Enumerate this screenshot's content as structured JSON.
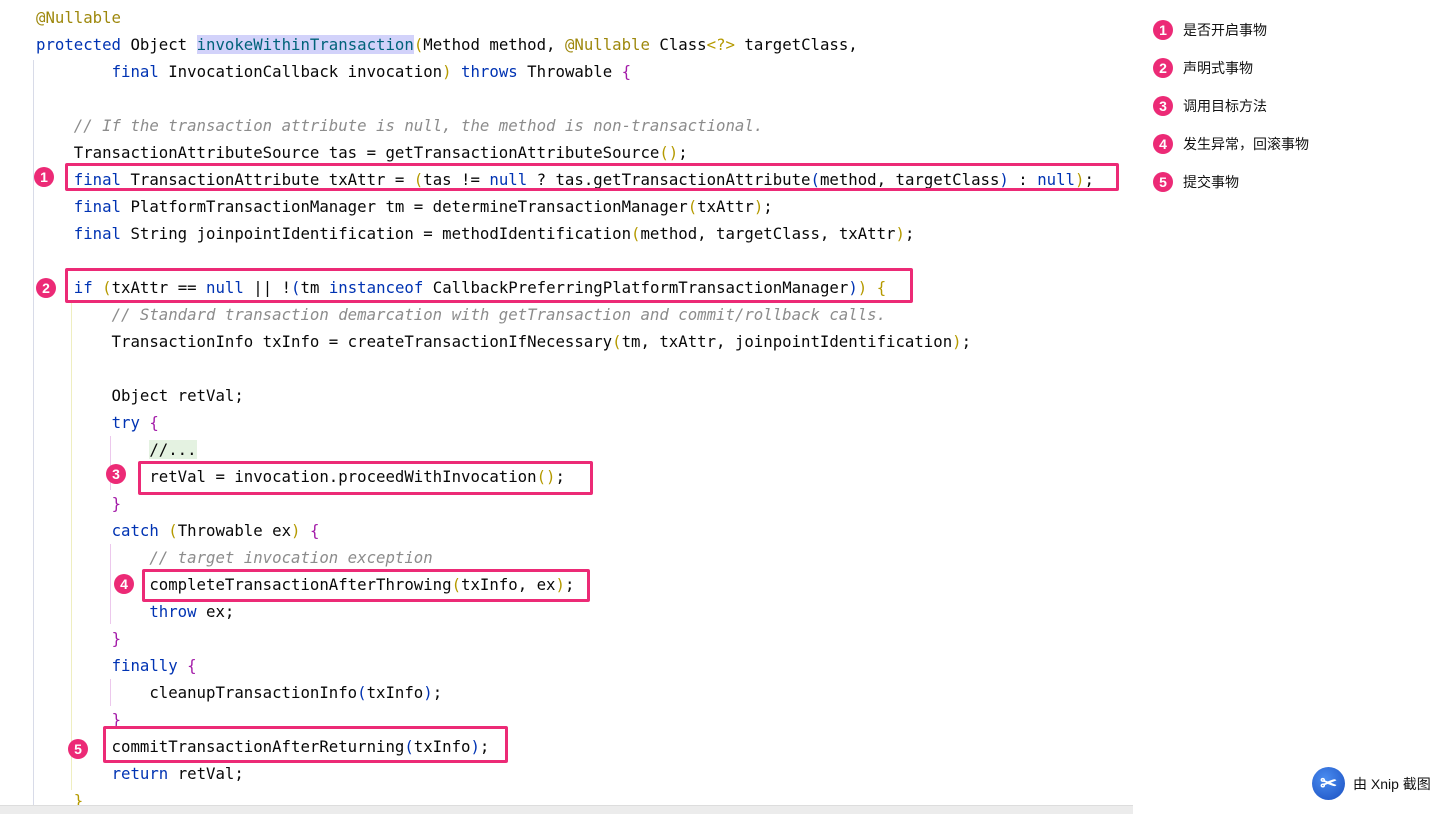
{
  "code": [
    [
      [
        "a",
        "@Nullable"
      ]
    ],
    [
      [
        "k",
        "protected "
      ],
      [
        "p",
        "Object "
      ],
      [
        "m",
        "invokeWithinTransaction"
      ],
      [
        "y",
        "("
      ],
      [
        "p",
        "Method method, "
      ],
      [
        "a",
        "@Nullable "
      ],
      [
        "p",
        "Class"
      ],
      [
        "y",
        "<?>"
      ],
      [
        "p",
        " targetClass,"
      ]
    ],
    [
      [
        "p",
        "        "
      ],
      [
        "k",
        "final "
      ],
      [
        "p",
        "InvocationCallback invocation"
      ],
      [
        "y",
        ")"
      ],
      [
        "p",
        " "
      ],
      [
        "k",
        "throws "
      ],
      [
        "p",
        "Throwable "
      ],
      [
        "b",
        "{"
      ]
    ],
    [],
    [
      [
        "p",
        "    "
      ],
      [
        "c",
        "// If the transaction attribute is null, the method is non-transactional."
      ]
    ],
    [
      [
        "p",
        "    TransactionAttributeSource tas = getTransactionAttributeSource"
      ],
      [
        "y",
        "()"
      ],
      [
        "p",
        ";"
      ]
    ],
    [
      [
        "p",
        "    "
      ],
      [
        "k",
        "final "
      ],
      [
        "p",
        "TransactionAttribute txAttr = "
      ],
      [
        "y",
        "("
      ],
      [
        "p",
        "tas != "
      ],
      [
        "k",
        "null"
      ],
      [
        "p",
        " ? tas.getTransactionAttribute"
      ],
      [
        "bl",
        "("
      ],
      [
        "p",
        "method, targetClass"
      ],
      [
        "bl",
        ")"
      ],
      [
        "p",
        " : "
      ],
      [
        "k",
        "null"
      ],
      [
        "y",
        ")"
      ],
      [
        "p",
        ";"
      ]
    ],
    [
      [
        "p",
        "    "
      ],
      [
        "k",
        "final "
      ],
      [
        "p",
        "PlatformTransactionManager tm = determineTransactionManager"
      ],
      [
        "y",
        "("
      ],
      [
        "p",
        "txAttr"
      ],
      [
        "y",
        ")"
      ],
      [
        "p",
        ";"
      ]
    ],
    [
      [
        "p",
        "    "
      ],
      [
        "k",
        "final "
      ],
      [
        "p",
        "String joinpointIdentification = methodIdentification"
      ],
      [
        "y",
        "("
      ],
      [
        "p",
        "method, targetClass, txAttr"
      ],
      [
        "y",
        ")"
      ],
      [
        "p",
        ";"
      ]
    ],
    [],
    [
      [
        "p",
        "    "
      ],
      [
        "k",
        "if "
      ],
      [
        "y",
        "("
      ],
      [
        "p",
        "txAttr == "
      ],
      [
        "k",
        "null"
      ],
      [
        "p",
        " || !"
      ],
      [
        "bl",
        "("
      ],
      [
        "p",
        "tm "
      ],
      [
        "k",
        "instanceof "
      ],
      [
        "p",
        "CallbackPreferringPlatformTransactionManager"
      ],
      [
        "bl",
        ")"
      ],
      [
        "y",
        ")"
      ],
      [
        "p",
        " "
      ],
      [
        "y",
        "{"
      ]
    ],
    [
      [
        "p",
        "        "
      ],
      [
        "c",
        "// Standard transaction demarcation with getTransaction and commit/rollback calls."
      ]
    ],
    [
      [
        "p",
        "        TransactionInfo txInfo = createTransactionIfNecessary"
      ],
      [
        "y",
        "("
      ],
      [
        "p",
        "tm, txAttr, joinpointIdentification"
      ],
      [
        "y",
        ")"
      ],
      [
        "p",
        ";"
      ]
    ],
    [],
    [
      [
        "p",
        "        Object retVal;"
      ]
    ],
    [
      [
        "p",
        "        "
      ],
      [
        "k",
        "try "
      ],
      [
        "b",
        "{"
      ]
    ],
    [
      [
        "p",
        "            "
      ],
      [
        "g",
        "//..."
      ]
    ],
    [
      [
        "p",
        "            retVal = invocation.proceedWithInvocation"
      ],
      [
        "y",
        "()"
      ],
      [
        "p",
        ";"
      ]
    ],
    [
      [
        "p",
        "        "
      ],
      [
        "b",
        "}"
      ]
    ],
    [
      [
        "p",
        "        "
      ],
      [
        "k",
        "catch "
      ],
      [
        "y",
        "("
      ],
      [
        "p",
        "Throwable ex"
      ],
      [
        "y",
        ")"
      ],
      [
        "p",
        " "
      ],
      [
        "b",
        "{"
      ]
    ],
    [
      [
        "p",
        "            "
      ],
      [
        "c",
        "// target invocation exception"
      ]
    ],
    [
      [
        "p",
        "            completeTransactionAfterThrowing"
      ],
      [
        "y",
        "("
      ],
      [
        "p",
        "txInfo, ex"
      ],
      [
        "y",
        ")"
      ],
      [
        "p",
        ";"
      ]
    ],
    [
      [
        "p",
        "            "
      ],
      [
        "k",
        "throw "
      ],
      [
        "p",
        "ex;"
      ]
    ],
    [
      [
        "p",
        "        "
      ],
      [
        "b",
        "}"
      ]
    ],
    [
      [
        "p",
        "        "
      ],
      [
        "k",
        "finally "
      ],
      [
        "b",
        "{"
      ]
    ],
    [
      [
        "p",
        "            cleanupTransactionInfo"
      ],
      [
        "bl",
        "("
      ],
      [
        "p",
        "txInfo"
      ],
      [
        "bl",
        ")"
      ],
      [
        "p",
        ";"
      ]
    ],
    [
      [
        "p",
        "        "
      ],
      [
        "b",
        "}"
      ]
    ],
    [
      [
        "p",
        "        commitTransactionAfterReturning"
      ],
      [
        "bl",
        "("
      ],
      [
        "p",
        "txInfo"
      ],
      [
        "bl",
        ")"
      ],
      [
        "p",
        ";"
      ]
    ],
    [
      [
        "p",
        "        "
      ],
      [
        "k",
        "return "
      ],
      [
        "p",
        "retVal;"
      ]
    ],
    [
      [
        "p",
        "    "
      ],
      [
        "y",
        "}"
      ]
    ]
  ],
  "markers": [
    "1",
    "2",
    "3",
    "4",
    "5"
  ],
  "legend": [
    {
      "num": "1",
      "text": "是否开启事物"
    },
    {
      "num": "2",
      "text": "声明式事物"
    },
    {
      "num": "3",
      "text": "调用目标方法"
    },
    {
      "num": "4",
      "text": "发生异常，回滚事物"
    },
    {
      "num": "5",
      "text": "提交事物"
    }
  ],
  "watermark": {
    "text": "由 Xnip 截图",
    "logo": "scissors-icon"
  },
  "colors": {
    "highlight": "#ec2a76",
    "keyword": "#0033b3",
    "annotation": "#9e880d",
    "comment": "#8c8c8c"
  }
}
